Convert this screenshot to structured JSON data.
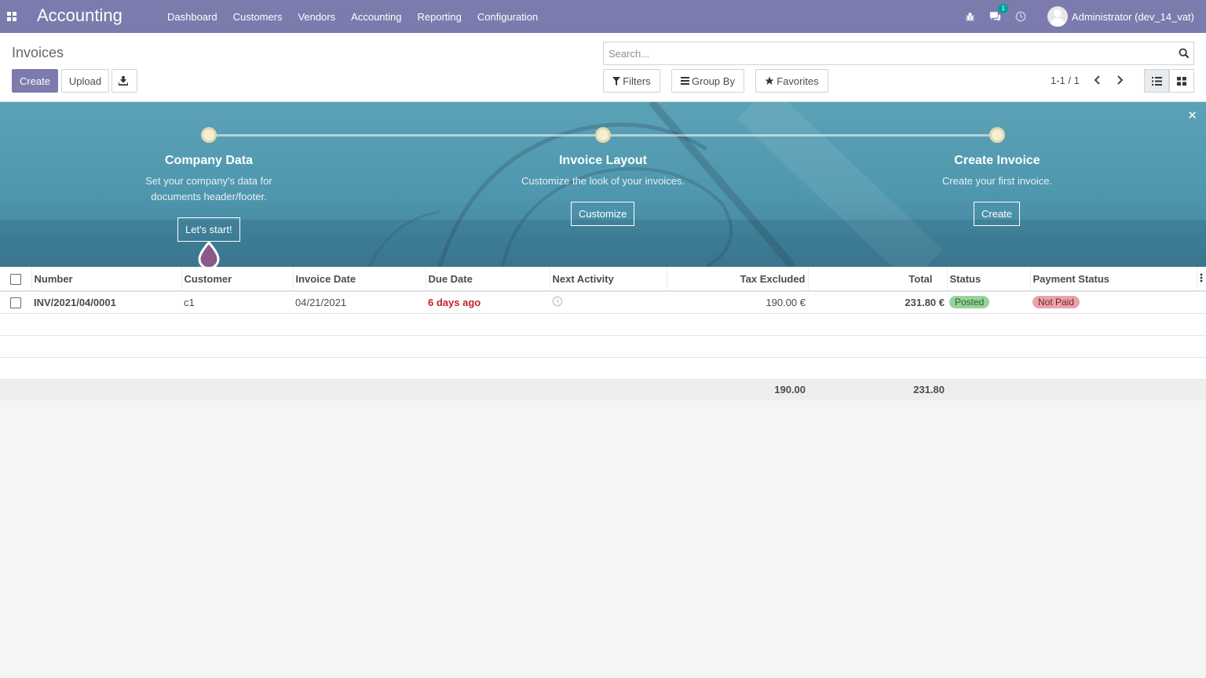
{
  "navbar": {
    "app_name": "Accounting",
    "menu": [
      "Dashboard",
      "Customers",
      "Vendors",
      "Accounting",
      "Reporting",
      "Configuration"
    ],
    "messages_badge": "1",
    "user_name": "Administrator (dev_14_vat)",
    "brand_color": "#7c7bad"
  },
  "control_panel": {
    "breadcrumb": "Invoices",
    "create_label": "Create",
    "upload_label": "Upload",
    "search_placeholder": "Search...",
    "filters_label": "Filters",
    "group_by_label": "Group By",
    "favorites_label": "Favorites",
    "pager_value": "1-1 / 1"
  },
  "onboarding": {
    "steps": [
      {
        "title": "Company Data",
        "description_line1": "Set your company's data for",
        "description_line2": "documents header/footer.",
        "button": "Let's start!"
      },
      {
        "title": "Invoice Layout",
        "description_line1": "Customize the look of your invoices.",
        "description_line2": "",
        "button": "Customize"
      },
      {
        "title": "Create Invoice",
        "description_line1": "Create your first invoice.",
        "description_line2": "",
        "button": "Create"
      }
    ]
  },
  "table": {
    "columns": [
      "Number",
      "Customer",
      "Invoice Date",
      "Due Date",
      "Next Activity",
      "Tax Excluded",
      "Total",
      "Status",
      "Payment Status"
    ],
    "rows": [
      {
        "number": "INV/2021/04/0001",
        "customer": "c1",
        "invoice_date": "04/21/2021",
        "due_date": "6 days ago",
        "next_activity": "",
        "tax_excluded": "190.00 €",
        "total": "231.80 €",
        "status": "Posted",
        "payment_status": "Not Paid"
      }
    ],
    "totals": {
      "tax_excluded": "190.00",
      "total": "231.80"
    }
  }
}
